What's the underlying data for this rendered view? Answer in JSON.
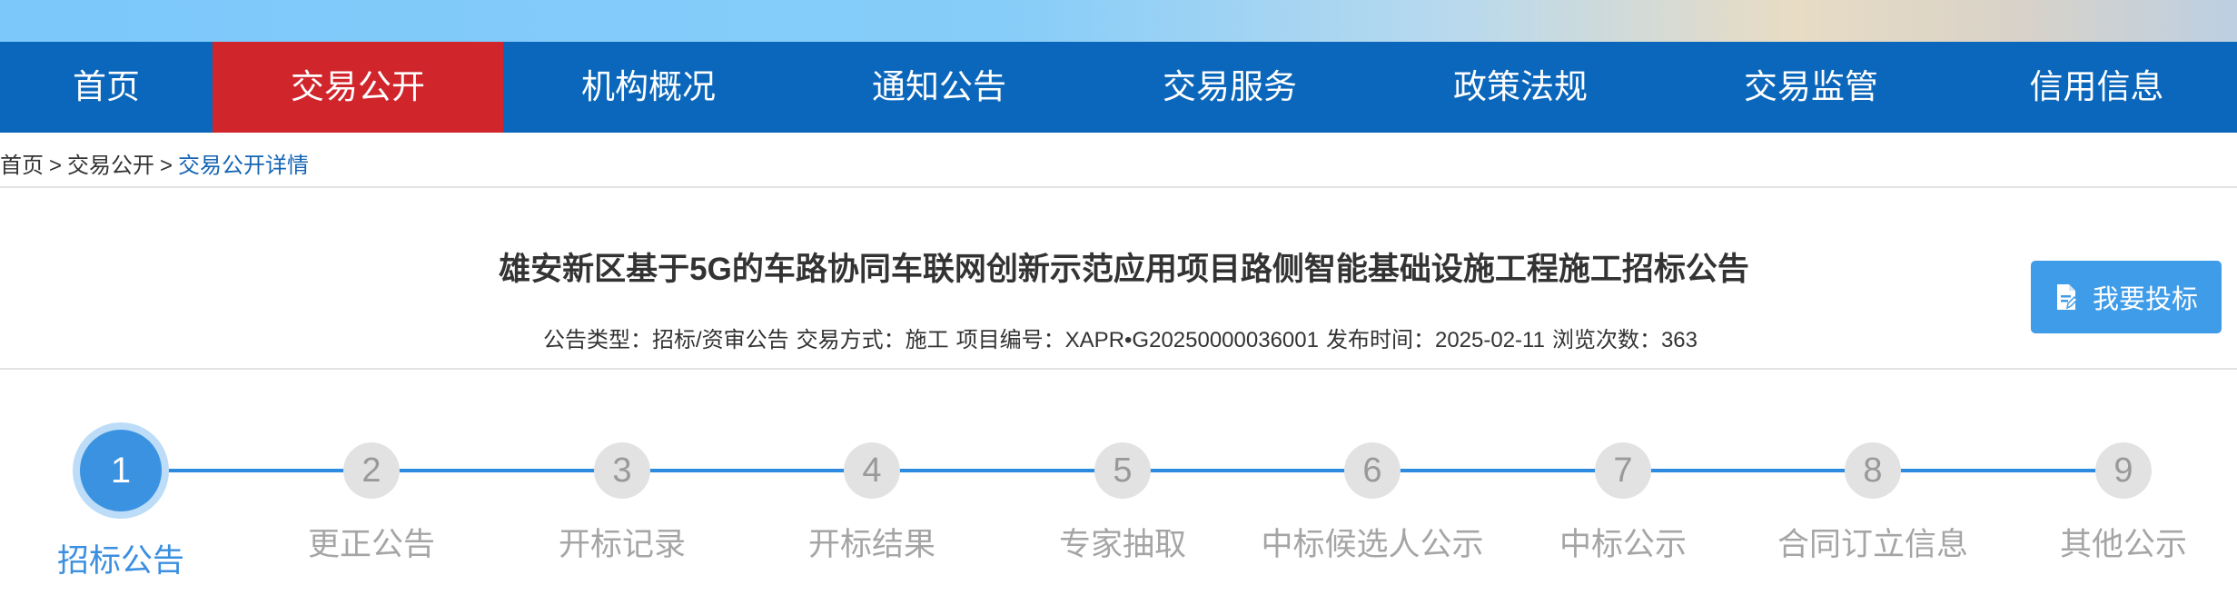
{
  "nav": {
    "items": [
      {
        "label": "首页",
        "active": false
      },
      {
        "label": "交易公开",
        "active": true
      },
      {
        "label": "机构概况",
        "active": false
      },
      {
        "label": "通知公告",
        "active": false
      },
      {
        "label": "交易服务",
        "active": false
      },
      {
        "label": "政策法规",
        "active": false
      },
      {
        "label": "交易监管",
        "active": false
      },
      {
        "label": "信用信息",
        "active": false
      }
    ]
  },
  "breadcrumb": {
    "home": "首页",
    "sep1": ">",
    "section": "交易公开",
    "sep2": ">",
    "current": "交易公开详情"
  },
  "article": {
    "title": "雄安新区基于5G的车路协同车联网创新示范应用项目路侧智能基础设施工程施工招标公告",
    "meta": {
      "type": "公告类型：招标/资审公告",
      "method": "交易方式：施工",
      "project_no": "项目编号：XAPR•G20250000036001",
      "publish_time": "发布时间：2025-02-11",
      "views": "浏览次数：363"
    }
  },
  "bid_button": {
    "label": "我要投标",
    "icon": "document-edit-icon"
  },
  "steps": [
    {
      "num": "1",
      "label": "招标公告",
      "active": true
    },
    {
      "num": "2",
      "label": "更正公告",
      "active": false
    },
    {
      "num": "3",
      "label": "开标记录",
      "active": false
    },
    {
      "num": "4",
      "label": "开标结果",
      "active": false
    },
    {
      "num": "5",
      "label": "专家抽取",
      "active": false
    },
    {
      "num": "6",
      "label": "中标候选人公示",
      "active": false
    },
    {
      "num": "7",
      "label": "中标公示",
      "active": false
    },
    {
      "num": "8",
      "label": "合同订立信息",
      "active": false
    },
    {
      "num": "9",
      "label": "其他公示",
      "active": false
    }
  ],
  "colors": {
    "nav_bg": "#0b67bb",
    "nav_active": "#d0252b",
    "accent": "#3b92e0",
    "inactive_step": "#e2e2e2"
  }
}
